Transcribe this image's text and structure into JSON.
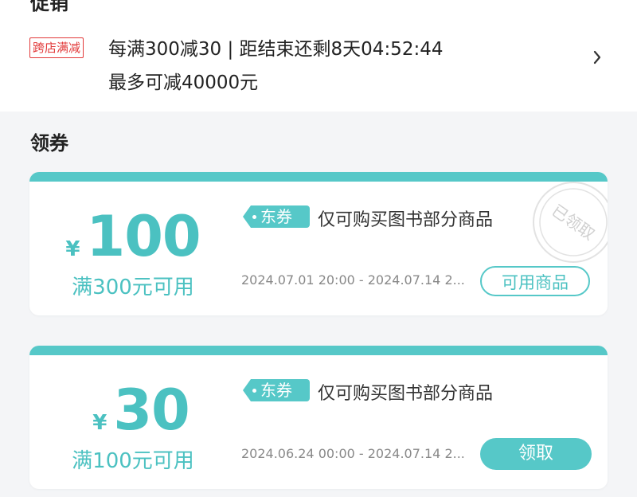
{
  "promo": {
    "header_title": "促销",
    "tag": "跨店满减",
    "line1": "每满300减30 | 距结束还剩8天04:52:44",
    "line2": "最多可减40000元"
  },
  "coupons_section": {
    "title": "领券",
    "coupons": [
      {
        "currency": "¥",
        "amount": "100",
        "condition": "满300元可用",
        "tag": "东券",
        "description": "仅可购买图书部分商品",
        "validity": "2024.07.01 20:00 - 2024.07.14 2...",
        "button": "可用商品",
        "stamp": "已领取"
      },
      {
        "currency": "¥",
        "amount": "30",
        "condition": "满100元可用",
        "tag": "东券",
        "description": "仅可购买图书部分商品",
        "validity": "2024.06.24 00:00 - 2024.07.14 2...",
        "button": "领取"
      }
    ]
  },
  "colors": {
    "accent": "#56c8c8",
    "promo_red": "#e23a3a"
  },
  "icons": [
    "chevron-right-icon"
  ]
}
